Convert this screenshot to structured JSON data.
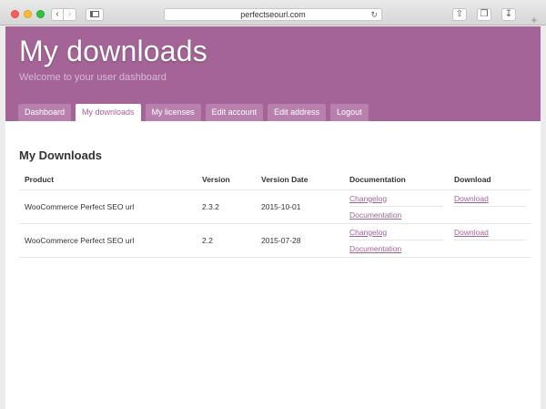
{
  "browser": {
    "url": "perfectseourl.com",
    "reload_icon": "reload-icon",
    "back_icon": "chevron-left-icon",
    "forward_icon": "chevron-right-icon"
  },
  "header": {
    "title": "My downloads",
    "subtitle": "Welcome to your user dashboard",
    "bg_color": "#a46497"
  },
  "nav": {
    "tabs": [
      {
        "label": "Dashboard"
      },
      {
        "label": "My downloads",
        "active": true
      },
      {
        "label": "My licenses"
      },
      {
        "label": "Edit account"
      },
      {
        "label": "Edit address"
      },
      {
        "label": "Logout"
      }
    ]
  },
  "main": {
    "section_title": "My Downloads",
    "table": {
      "headers": [
        "Product",
        "Version",
        "Version Date",
        "Documentation",
        "Download"
      ],
      "rows": [
        {
          "product": "WooCommerce Perfect SEO url",
          "version": "2.3.2",
          "date": "2015-10-01",
          "docs": [
            "Changelog",
            "Documentation"
          ],
          "download": "Download"
        },
        {
          "product": "WooCommerce Perfect SEO url",
          "version": "2.2",
          "date": "2015-07-28",
          "docs": [
            "Changelog",
            "Documentation"
          ],
          "download": "Download"
        }
      ]
    }
  }
}
